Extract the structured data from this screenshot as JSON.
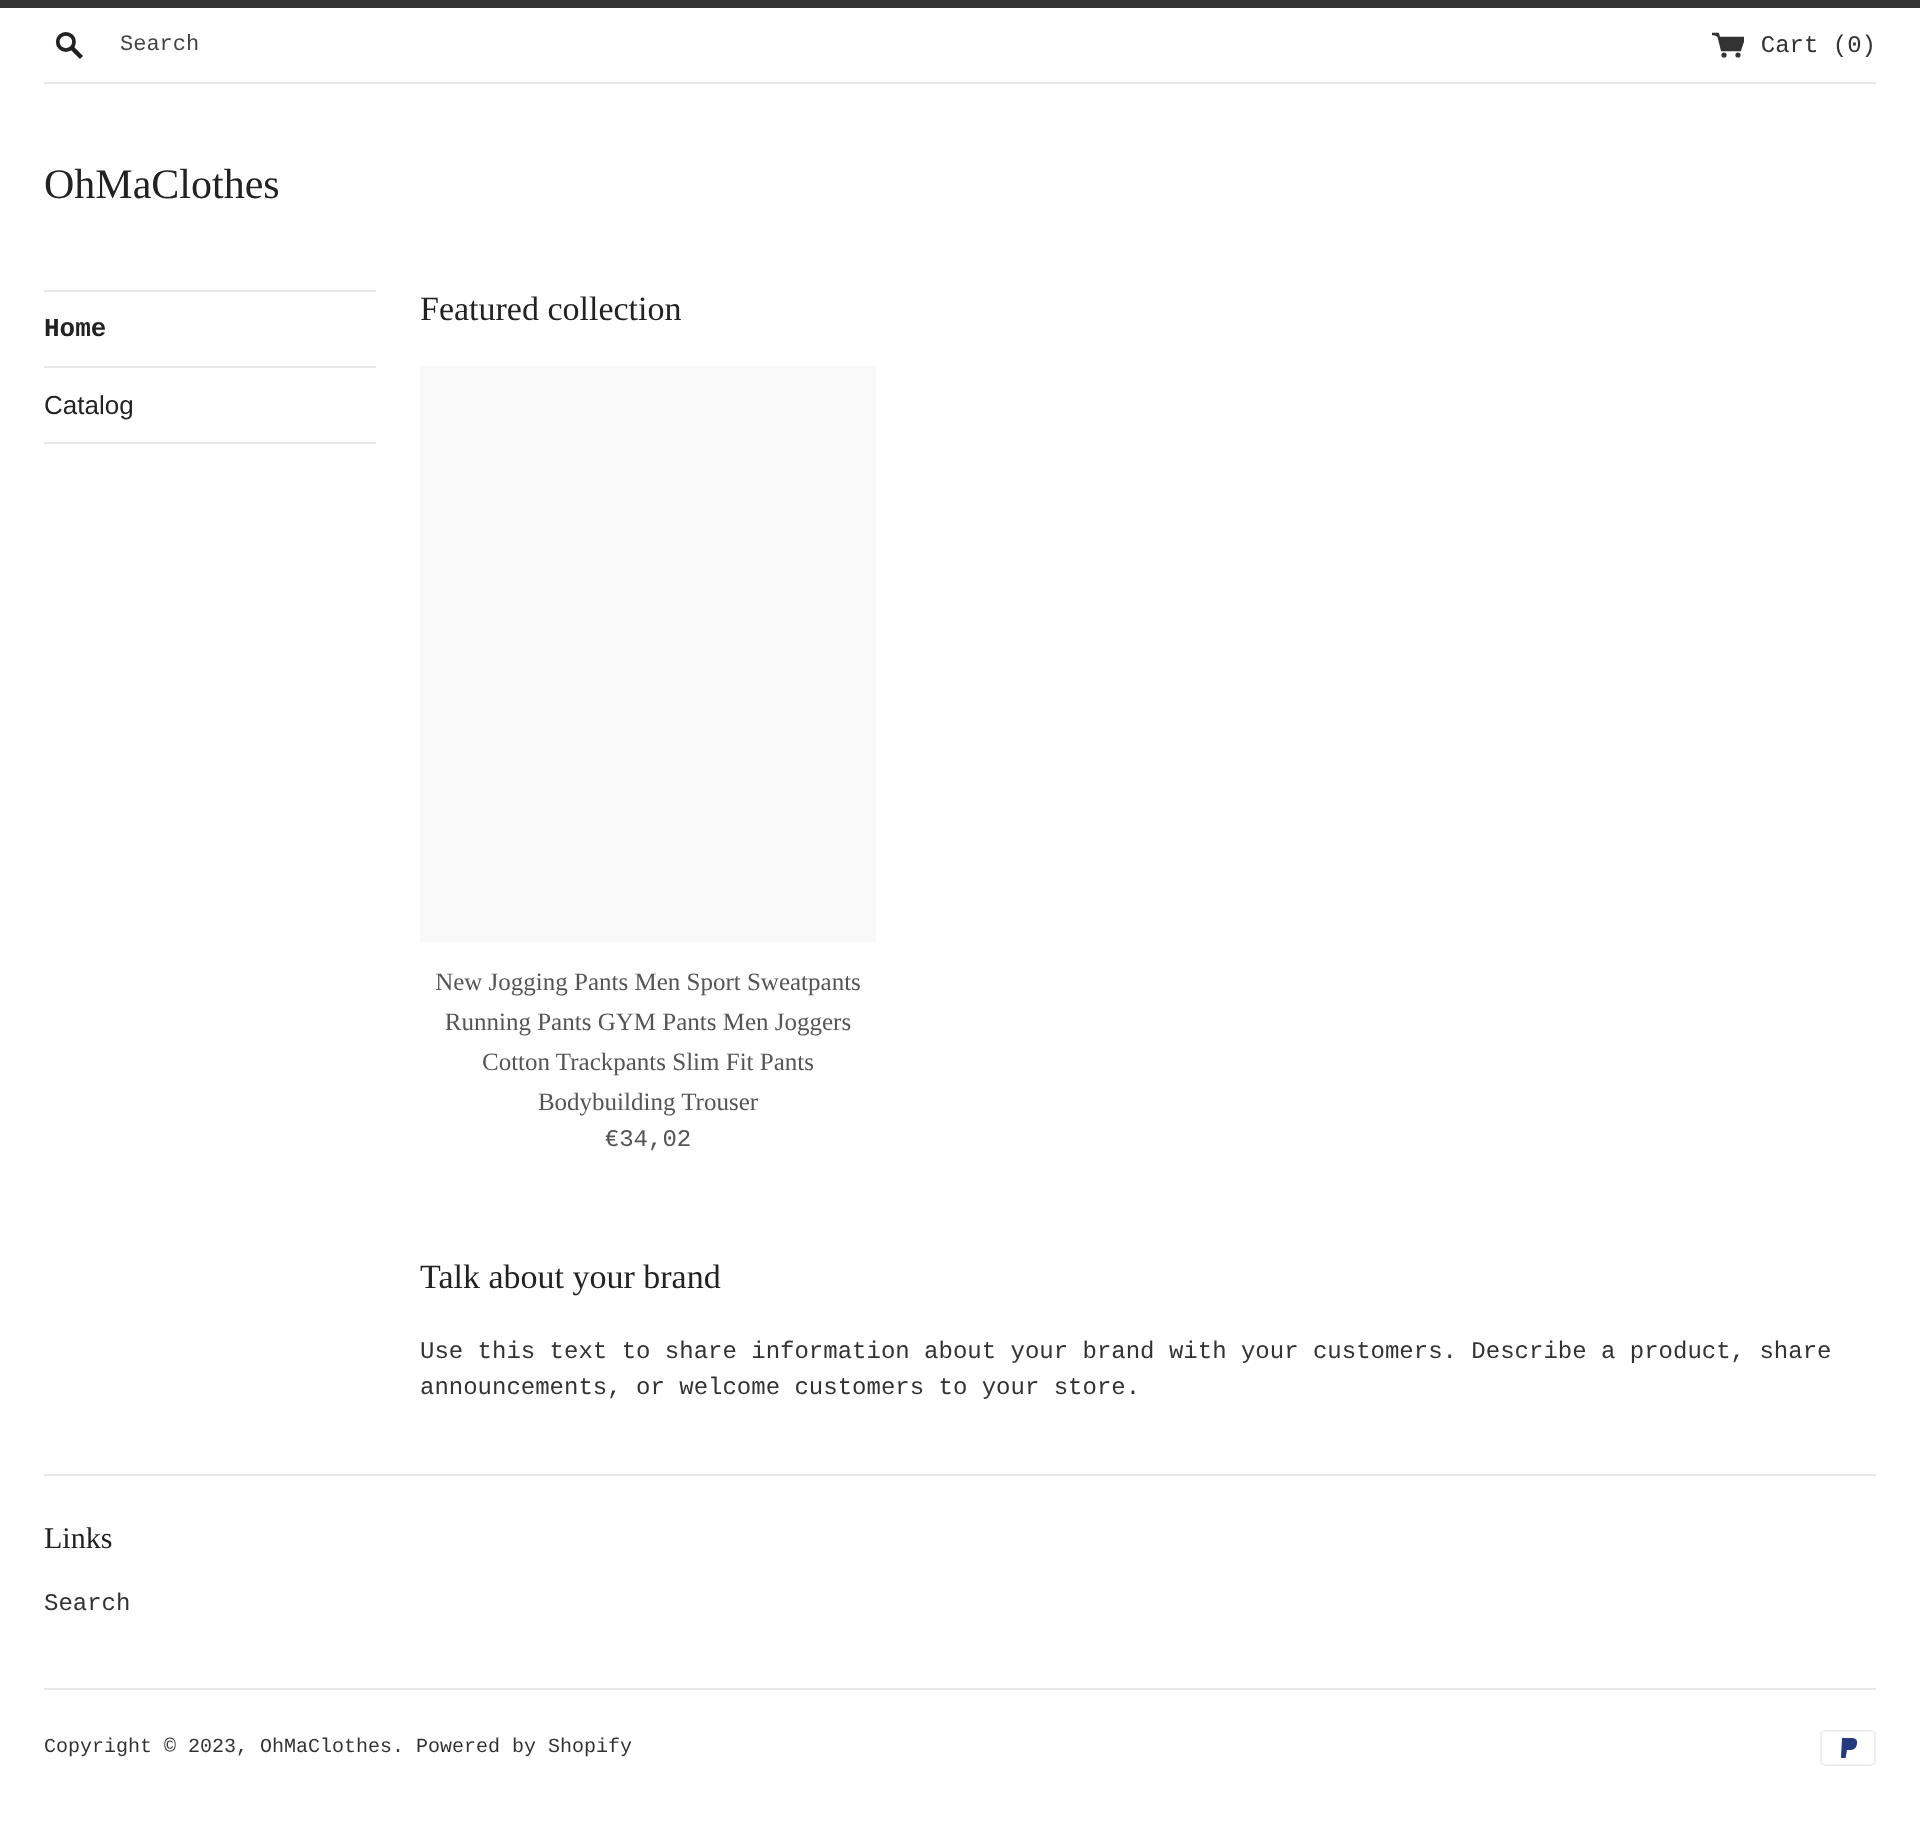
{
  "header": {
    "search": {
      "placeholder": "Search"
    },
    "cart": "Cart (0)"
  },
  "site_title": "OhMaClothes",
  "sidebar": {
    "items": [
      {
        "label": "Home",
        "selected": true
      },
      {
        "label": "Catalog",
        "selected": false
      }
    ]
  },
  "featured": {
    "title": "Featured collection",
    "products": [
      {
        "title": "New Jogging Pants Men Sport Sweatpants Running Pants GYM Pants Men Joggers Cotton Trackpants Slim Fit Pants Bodybuilding Trouser",
        "price": "€34,02"
      }
    ]
  },
  "brand": {
    "title": "Talk about your brand",
    "text": "Use this text to share information about your brand with your customers. Describe a product, share announcements, or welcome customers to your store."
  },
  "footer": {
    "links_title": "Links",
    "links": [
      "Search"
    ],
    "copyright": "Copyright © 2023, OhMaClothes. Powered by Shopify"
  }
}
